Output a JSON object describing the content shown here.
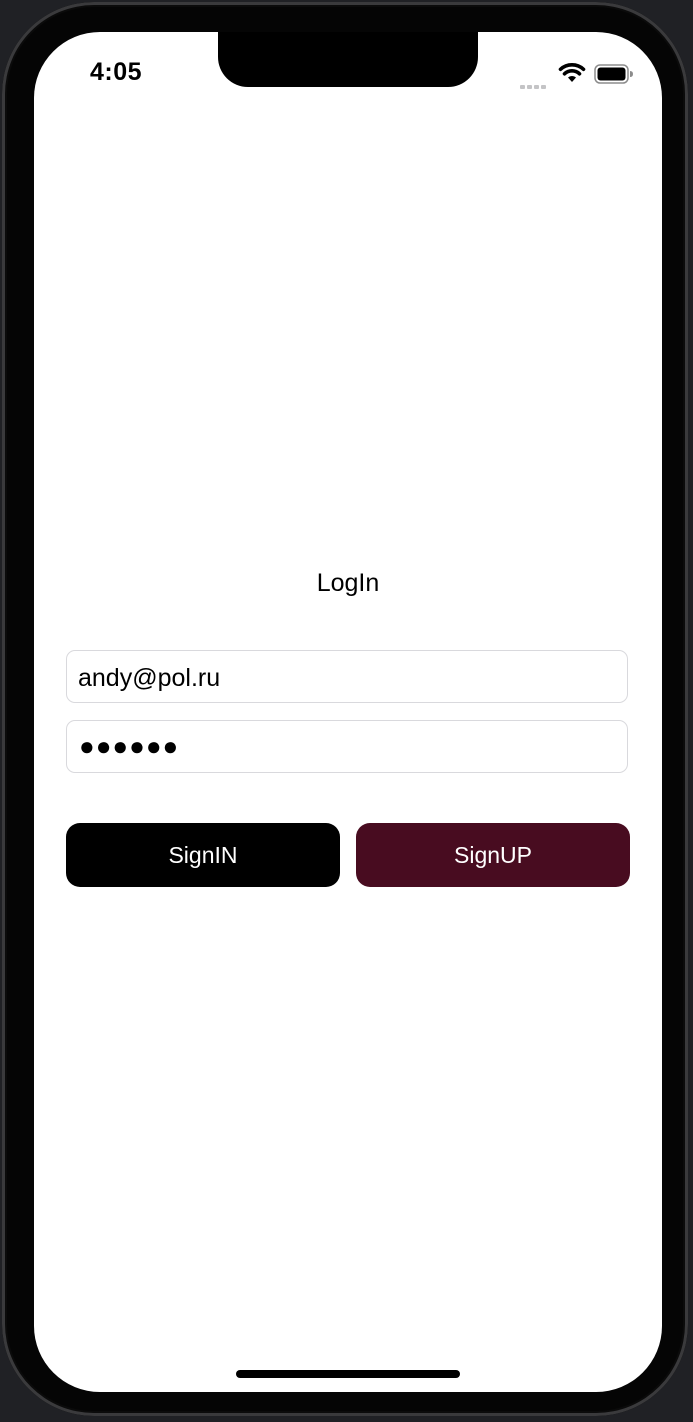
{
  "status_bar": {
    "time": "4:05"
  },
  "login": {
    "title": "LogIn",
    "email_value": "andy@pol.ru",
    "password_masked": "●●●●●●"
  },
  "buttons": {
    "signin_label": "SignIN",
    "signup_label": "SignUP"
  },
  "colors": {
    "signin_bg": "#000000",
    "signup_bg": "#480c20",
    "field_border": "#d9d9dd"
  }
}
